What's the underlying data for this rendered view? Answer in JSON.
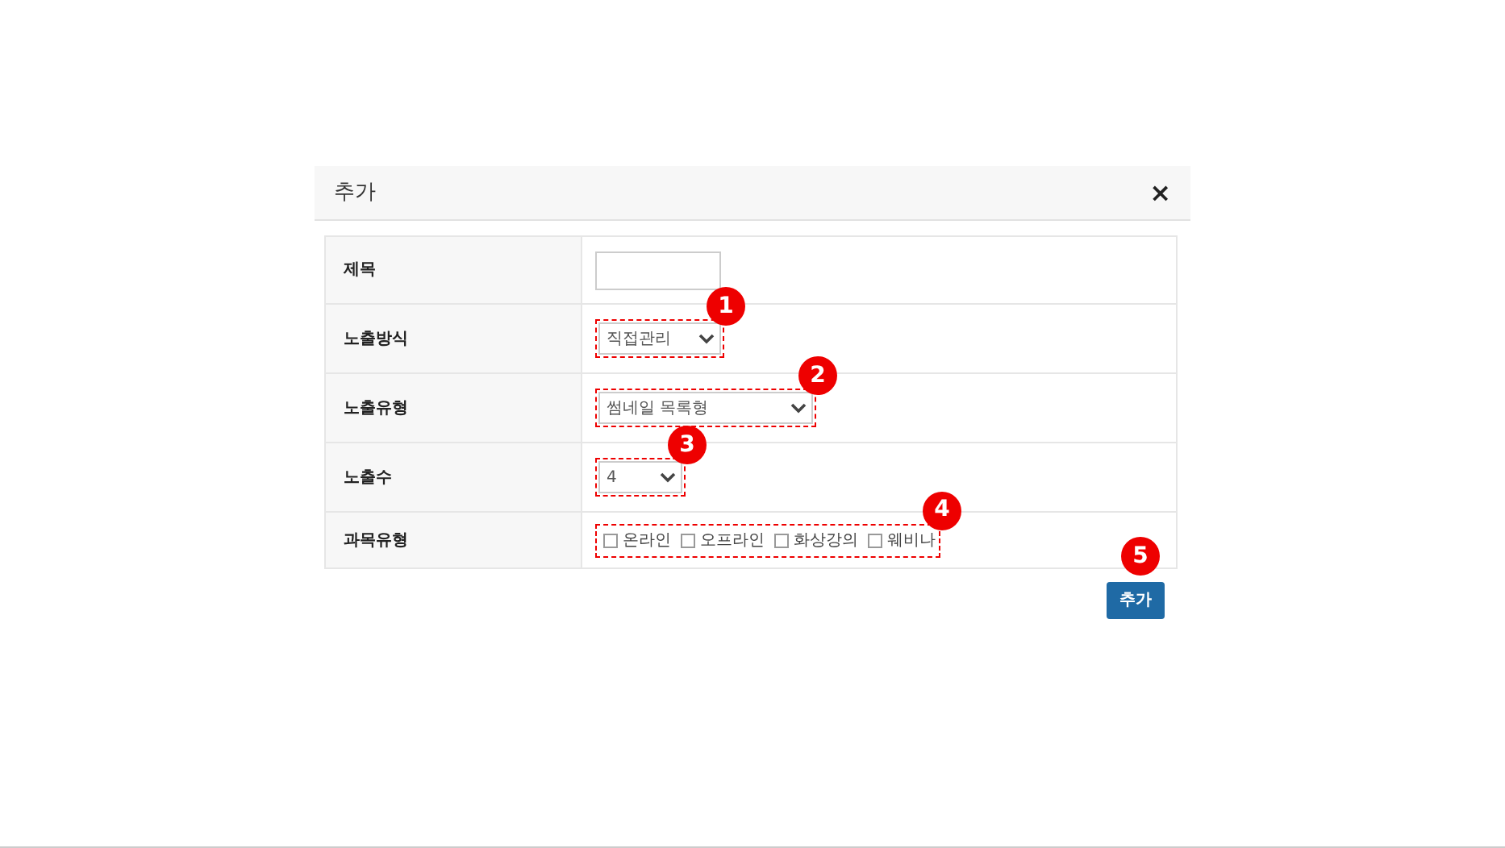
{
  "dialog": {
    "title": "추가",
    "close": "×"
  },
  "rows": [
    {
      "label": "제목",
      "kind": "text"
    },
    {
      "label": "노출방식",
      "kind": "select",
      "value": "직접관리",
      "marker": "1"
    },
    {
      "label": "노출유형",
      "kind": "select",
      "value": "썸네일 목록형",
      "marker": "2"
    },
    {
      "label": "노출수",
      "kind": "select",
      "value": "4",
      "marker": "3"
    },
    {
      "label": "과목유형",
      "kind": "checkboxes",
      "marker": "4",
      "options": [
        {
          "label": "온라인",
          "checked": false
        },
        {
          "label": "오프라인",
          "checked": false
        },
        {
          "label": "화상강의",
          "checked": false
        },
        {
          "label": "웨비나",
          "checked": false
        }
      ]
    }
  ],
  "submit": {
    "label": "추가",
    "marker": "5"
  }
}
